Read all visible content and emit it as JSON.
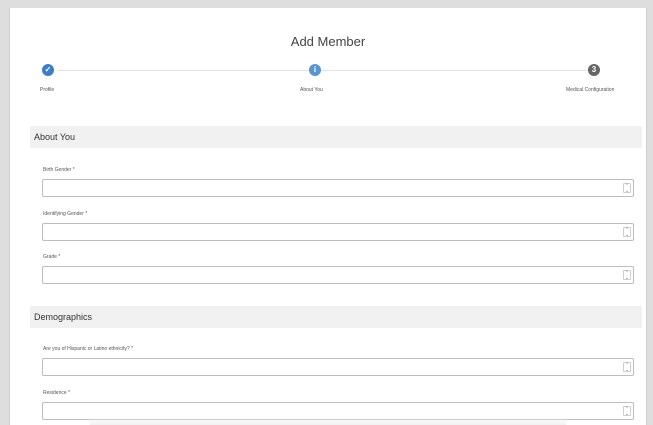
{
  "dialog": {
    "title": "Add Member"
  },
  "stepper": {
    "steps": [
      {
        "label": "Profile",
        "state": "done",
        "icon": "check-icon"
      },
      {
        "label": "About You",
        "state": "current",
        "icon": "info-icon"
      },
      {
        "label": "Medical Configuration",
        "state": "pending",
        "icon": "number-icon",
        "number": "3"
      }
    ]
  },
  "sections": {
    "about_you": {
      "title": "About You",
      "fields": [
        {
          "label": "Birth Gender *",
          "value": ""
        },
        {
          "label": "Identifying Gender *",
          "value": ""
        },
        {
          "label": "Grade *",
          "value": ""
        }
      ]
    },
    "demographics": {
      "title": "Demographics",
      "fields": [
        {
          "label": "Are you of Hispanic or Latino ethnicity? *",
          "value": ""
        },
        {
          "label": "Residence *",
          "value": ""
        }
      ]
    }
  },
  "colors": {
    "accent": "#3b7fc4",
    "section_bg": "#f1f1f1",
    "pending": "#666666"
  }
}
